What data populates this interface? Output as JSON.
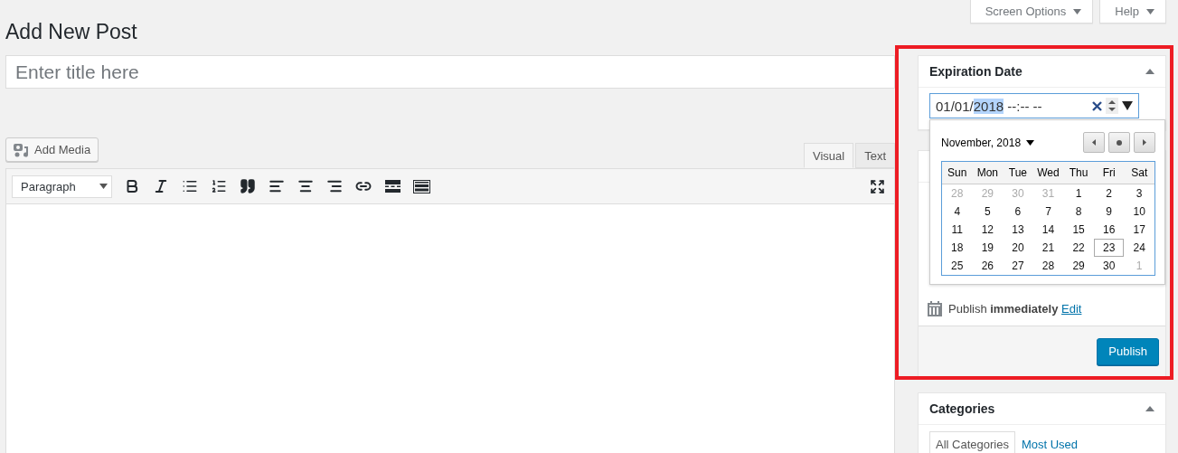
{
  "header_buttons": [
    {
      "label": "Screen Options"
    },
    {
      "label": "Help"
    }
  ],
  "page_title": "Add New Post",
  "title_field": {
    "placeholder": "Enter title here"
  },
  "add_media": {
    "label": "Add Media"
  },
  "editor_tabs": [
    {
      "label": "Visual",
      "selected": true
    },
    {
      "label": "Text",
      "selected": false
    }
  ],
  "format_select": {
    "value": "Paragraph"
  },
  "expiration_box": {
    "title": "Expiration Date",
    "date_field": [
      {
        "text": "01/01/",
        "selected": false
      },
      {
        "text": "2018",
        "selected": true
      },
      {
        "text": " --:-- --",
        "selected": false
      }
    ]
  },
  "calendar": {
    "month_label": "November, 2018",
    "weekdays": [
      "Sun",
      "Mon",
      "Tue",
      "Wed",
      "Thu",
      "Fri",
      "Sat"
    ],
    "weeks": [
      [
        {
          "day": "28",
          "outside": true,
          "selected": false
        },
        {
          "day": "29",
          "outside": true,
          "selected": false
        },
        {
          "day": "30",
          "outside": true,
          "selected": false
        },
        {
          "day": "31",
          "outside": true,
          "selected": false
        },
        {
          "day": "1",
          "outside": false,
          "selected": false
        },
        {
          "day": "2",
          "outside": false,
          "selected": false
        },
        {
          "day": "3",
          "outside": false,
          "selected": false
        }
      ],
      [
        {
          "day": "4",
          "outside": false,
          "selected": false
        },
        {
          "day": "5",
          "outside": false,
          "selected": false
        },
        {
          "day": "6",
          "outside": false,
          "selected": false
        },
        {
          "day": "7",
          "outside": false,
          "selected": false
        },
        {
          "day": "8",
          "outside": false,
          "selected": false
        },
        {
          "day": "9",
          "outside": false,
          "selected": false
        },
        {
          "day": "10",
          "outside": false,
          "selected": false
        }
      ],
      [
        {
          "day": "11",
          "outside": false,
          "selected": false
        },
        {
          "day": "12",
          "outside": false,
          "selected": false
        },
        {
          "day": "13",
          "outside": false,
          "selected": false
        },
        {
          "day": "14",
          "outside": false,
          "selected": false
        },
        {
          "day": "15",
          "outside": false,
          "selected": false
        },
        {
          "day": "16",
          "outside": false,
          "selected": false
        },
        {
          "day": "17",
          "outside": false,
          "selected": false
        }
      ],
      [
        {
          "day": "18",
          "outside": false,
          "selected": false
        },
        {
          "day": "19",
          "outside": false,
          "selected": false
        },
        {
          "day": "20",
          "outside": false,
          "selected": false
        },
        {
          "day": "21",
          "outside": false,
          "selected": false
        },
        {
          "day": "22",
          "outside": false,
          "selected": false
        },
        {
          "day": "23",
          "outside": false,
          "selected": true
        },
        {
          "day": "24",
          "outside": false,
          "selected": false
        }
      ],
      [
        {
          "day": "25",
          "outside": false,
          "selected": false
        },
        {
          "day": "26",
          "outside": false,
          "selected": false
        },
        {
          "day": "27",
          "outside": false,
          "selected": false
        },
        {
          "day": "28",
          "outside": false,
          "selected": false
        },
        {
          "day": "29",
          "outside": false,
          "selected": false
        },
        {
          "day": "30",
          "outside": false,
          "selected": false
        },
        {
          "day": "1",
          "outside": true,
          "selected": false
        }
      ]
    ]
  },
  "publish": {
    "status": "Publish **immediately**",
    "edit_link": "Edit",
    "button": "Publish"
  },
  "categories": {
    "title": "Categories",
    "tabs": [
      {
        "label": "All Categories",
        "selected": true
      },
      {
        "label": "Most Used",
        "selected": false
      }
    ]
  }
}
